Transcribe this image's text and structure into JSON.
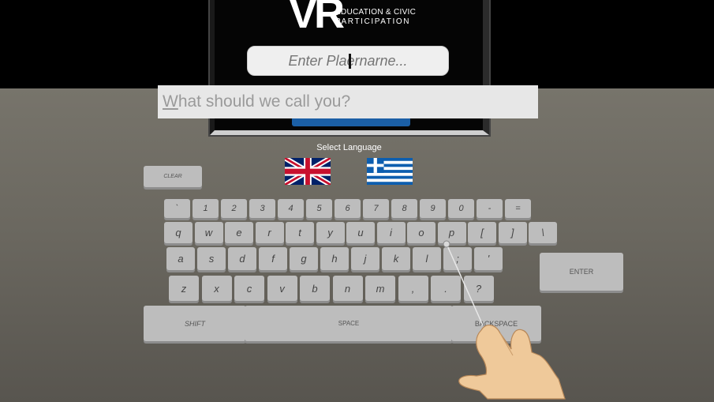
{
  "logo": {
    "vr": "VR",
    "line1": "EDUCATION & CIVIC",
    "line2": "PARTICIPATION"
  },
  "player_field": {
    "placeholder": "Enter Plaernarne...",
    "value": ""
  },
  "name_field": {
    "prefix": "W",
    "rest": "hat should we call you?"
  },
  "language": {
    "label": "Select Language",
    "options": [
      {
        "name": "uk-flag-icon"
      },
      {
        "name": "greece-flag-icon"
      }
    ]
  },
  "keyboard": {
    "rows": [
      [
        "`",
        "1",
        "2",
        "3",
        "4",
        "5",
        "6",
        "7",
        "8",
        "9",
        "0",
        "-",
        "="
      ],
      [
        "q",
        "w",
        "e",
        "r",
        "t",
        "y",
        "u",
        "i",
        "o",
        "p",
        "[",
        "]",
        "\\"
      ],
      [
        "a",
        "s",
        "d",
        "f",
        "g",
        "h",
        "j",
        "k",
        "l",
        ";",
        "'"
      ],
      [
        "z",
        "x",
        "c",
        "v",
        "b",
        "n",
        "m",
        ",",
        ".",
        "?"
      ]
    ],
    "clear": "CLEAR",
    "enter": "ENTER",
    "shift": "SHIFT",
    "space": "SPACE",
    "backspace": "BACKSPACE"
  },
  "colors": {
    "key_face": "#bdbdbd",
    "floor": "#77746b",
    "screen_accent": "#1b5fa6"
  }
}
